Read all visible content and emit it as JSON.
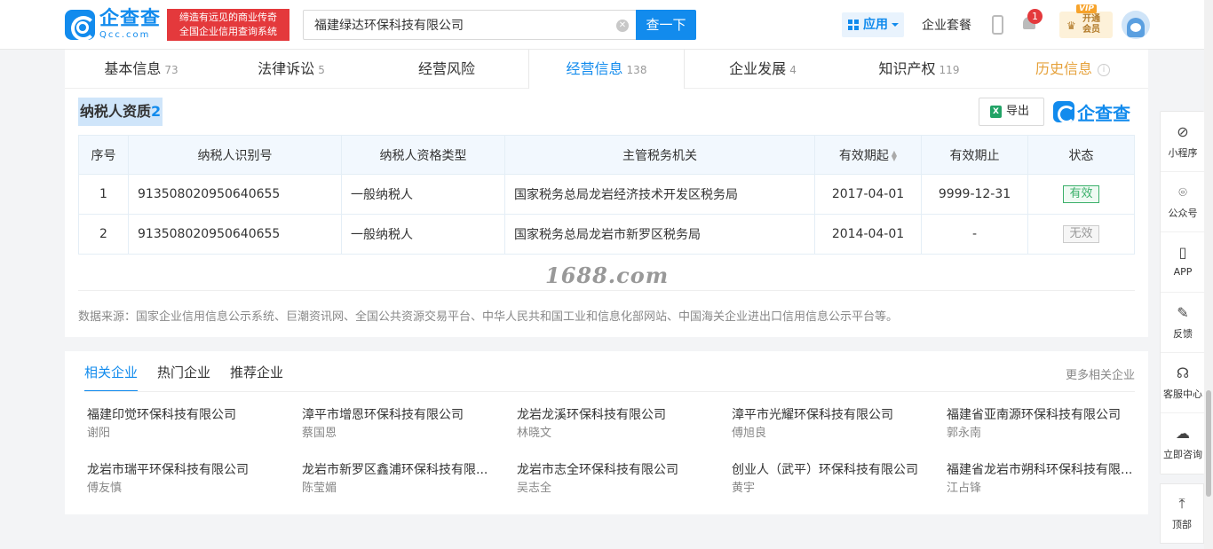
{
  "header": {
    "logo_cn": "企查查",
    "logo_en": "Qcc.com",
    "slogan_line1": "缔造有远见的商业传奇",
    "slogan_line2": "全国企业信用查询系统",
    "search_value": "福建绿达环保科技有限公司",
    "search_button": "查一下",
    "app_label": "应用",
    "enterprise_package": "企业套餐",
    "notification_count": "1",
    "vip_line1": "开通",
    "vip_line2": "会员",
    "vip_tag": "VIP"
  },
  "tabs": [
    {
      "label": "基本信息",
      "count": "73"
    },
    {
      "label": "法律诉讼",
      "count": "5"
    },
    {
      "label": "经营风险",
      "count": ""
    },
    {
      "label": "经营信息",
      "count": "138"
    },
    {
      "label": "企业发展",
      "count": "4"
    },
    {
      "label": "知识产权",
      "count": "119"
    },
    {
      "label": "历史信息",
      "count": ""
    }
  ],
  "section": {
    "title": "纳税人资质",
    "count": "2",
    "export_label": "导出",
    "logo_text": "企查查"
  },
  "table": {
    "headers": [
      "序号",
      "纳税人识别号",
      "纳税人资格类型",
      "主管税务机关",
      "有效期起",
      "有效期止",
      "状态"
    ],
    "rows": [
      {
        "index": "1",
        "tax_id": "913508020950640655",
        "type": "一般纳税人",
        "authority": "国家税务总局龙岩经济技术开发区税务局",
        "start": "2017-04-01",
        "end": "9999-12-31",
        "status": "有效"
      },
      {
        "index": "2",
        "tax_id": "913508020950640655",
        "type": "一般纳税人",
        "authority": "国家税务总局龙岩市新罗区税务局",
        "start": "2014-04-01",
        "end": "-",
        "status": "无效"
      }
    ]
  },
  "watermark": "1688.com",
  "source_note": "数据来源：国家企业信用信息公示系统、巨潮资讯网、全国公共资源交易平台、中华人民共和国工业和信息化部网站、中国海关企业进出口信用信息公示平台等。",
  "related": {
    "tabs": [
      "相关企业",
      "热门企业",
      "推荐企业"
    ],
    "more": "更多相关企业",
    "items": [
      {
        "name": "福建印觉环保科技有限公司",
        "person": "谢阳"
      },
      {
        "name": "漳平市增恩环保科技有限公司",
        "person": "蔡国恩"
      },
      {
        "name": "龙岩龙溪环保科技有限公司",
        "person": "林晓文"
      },
      {
        "name": "漳平市光耀环保科技有限公司",
        "person": "傅旭良"
      },
      {
        "name": "福建省亚南源环保科技有限公司",
        "person": "郭永南"
      },
      {
        "name": "龙岩市瑞平环保科技有限公司",
        "person": "傅友慎"
      },
      {
        "name": "龙岩市新罗区鑫浦环保科技有限...",
        "person": "陈莹媚"
      },
      {
        "name": "龙岩市志全环保科技有限公司",
        "person": "吴志全"
      },
      {
        "name": "创业人（武平）环保科技有限公司",
        "person": "黄宇"
      },
      {
        "name": "福建省龙岩市朔科环保科技有限...",
        "person": "江占锋"
      }
    ]
  },
  "sidebar": {
    "items": [
      "小程序",
      "公众号",
      "APP",
      "反馈",
      "客服中心",
      "立即咨询"
    ],
    "top": "顶部"
  }
}
